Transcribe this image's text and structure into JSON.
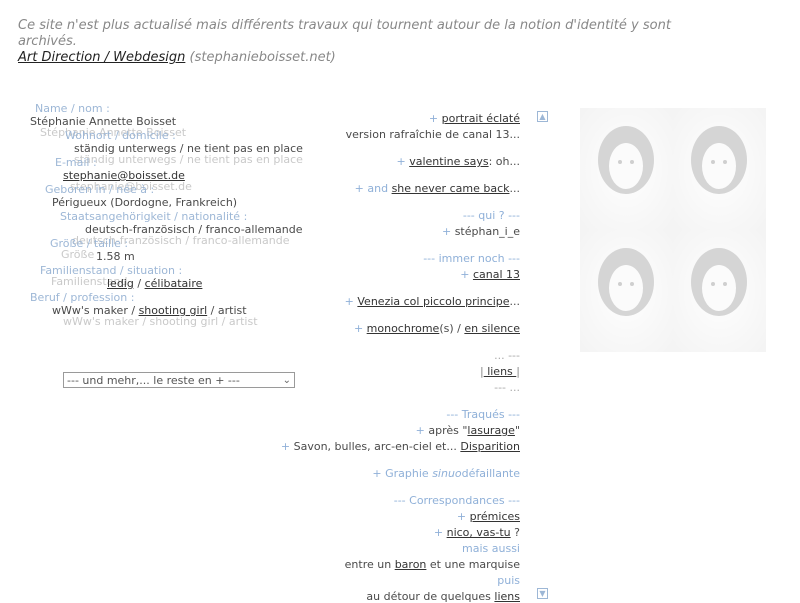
{
  "notice": {
    "text": "Ce site n'est plus actualisé mais différents travaux qui tournent autour de la notion d'identité y sont archivés.",
    "link_label": "Art Direction / Webdesign",
    "link_suffix": "(stephanieboisset.net)"
  },
  "profile": {
    "name_label": "Name / nom :",
    "name_value": "Stéphanie Annette Boisset",
    "domicile_label": "Wohnort / domicile :",
    "domicile_value": "ständig unterwegs / ne tient pas en place",
    "email_label": "E-mail :",
    "email_value": "stephanie@boisset.de",
    "born_label": "Geboren in / née à :",
    "born_value": "Périgueux (Dordogne, Frankreich)",
    "nationality_label": "Staatsangehörigkeit / nationalité :",
    "nationality_value": "deutsch-französisch / franco-allemande",
    "height_label": "Größe / taille :",
    "height_value": "1.58 m",
    "status_label": "Familienstand / situation :",
    "status_value_1": "ledig",
    "status_sep": "/",
    "status_value_2": "célibataire",
    "job_label": "Beruf / profession :",
    "job_value_1": "wWw's maker /",
    "job_value_link": "shooting girl",
    "job_value_2": "/ artist",
    "ghost_name": "Stéphanie Annette Boisset",
    "ghost_domicile": "ständig unterwegs / ne tient pas en place",
    "ghost_email": "stephanie@boisset.de",
    "ghost_nationality": "deutsch-französisch / franco-allemande",
    "ghost_height": "Größe",
    "ghost_status": "Familienstand",
    "ghost_job": "wWw's maker / shooting girl / artist"
  },
  "select": {
    "selected": "--- und mehr,... le reste en + ---"
  },
  "menu": {
    "portrait_link": "portrait éclaté",
    "portrait_desc": "version rafraîchie de canal 13...",
    "valentine_link": "valentine says",
    "valentine_suffix": ": oh...",
    "and_text": "and",
    "never_link": "she never came back",
    "never_suffix": "...",
    "qui_header": "--- qui ? ---",
    "stephan_text": "stéphan_i_e",
    "immer_header": "--- immer noch ---",
    "canal_link": "canal 13",
    "venezia_link": "Venezia col piccolo principe",
    "venezia_suffix": "...",
    "mono_link": "monochrome",
    "mono_suffix": "(s) /",
    "silence_link": "en silence",
    "dots_1": "... ---",
    "liens_link": " liens ",
    "dots_2": "--- ...",
    "traques_header": "--- Traqués ---",
    "apres_text": "après \"",
    "lasurage_link": "lasurage",
    "apres_close": "\"",
    "savon_text": "Savon, bulles, arc-en-ciel et...",
    "disparition_link": "Disparition",
    "graphie_text": "Graphie",
    "graphie_italic": "sinuo",
    "graphie_end": "défaillante",
    "corresp_header": "--- Correspondances ---",
    "premices_link": "prémices",
    "nico_link": "nico, vas-tu",
    "nico_suffix": "?",
    "mais_aussi": "mais aussi",
    "entre_text": "entre un",
    "baron_link": "baron",
    "entre_suffix": "et une marquise",
    "puis": "puis",
    "detour_text": "au détour de quelques",
    "detour_link": "liens"
  },
  "plus_symbol": "+"
}
